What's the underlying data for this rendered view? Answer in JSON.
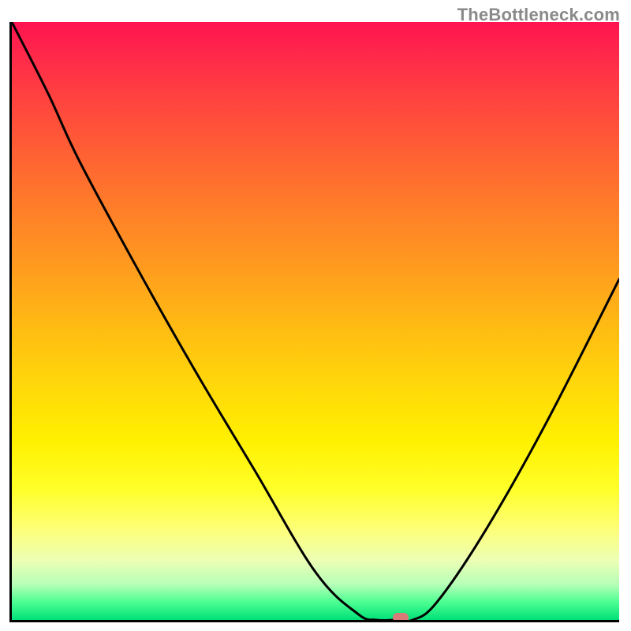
{
  "watermark": "TheBottleneck.com",
  "chart_data": {
    "type": "line",
    "title": "",
    "xlabel": "",
    "ylabel": "",
    "xlim": [
      0,
      100
    ],
    "ylim": [
      0,
      100
    ],
    "x": [
      0,
      6,
      11,
      20,
      30,
      40,
      50,
      57,
      60,
      63,
      66,
      70,
      78,
      88,
      100
    ],
    "values": [
      100,
      88,
      77,
      60,
      42,
      25,
      8,
      1,
      0,
      0,
      0,
      3,
      15,
      33,
      57
    ],
    "color_gradient": {
      "top": "#ff1450",
      "mid_high": "#ff9820",
      "mid": "#ffff28",
      "low": "#00e078"
    },
    "marker": {
      "x": 64,
      "y": 0.4,
      "color": "#d87b78"
    },
    "curve_stroke": "#000000"
  }
}
